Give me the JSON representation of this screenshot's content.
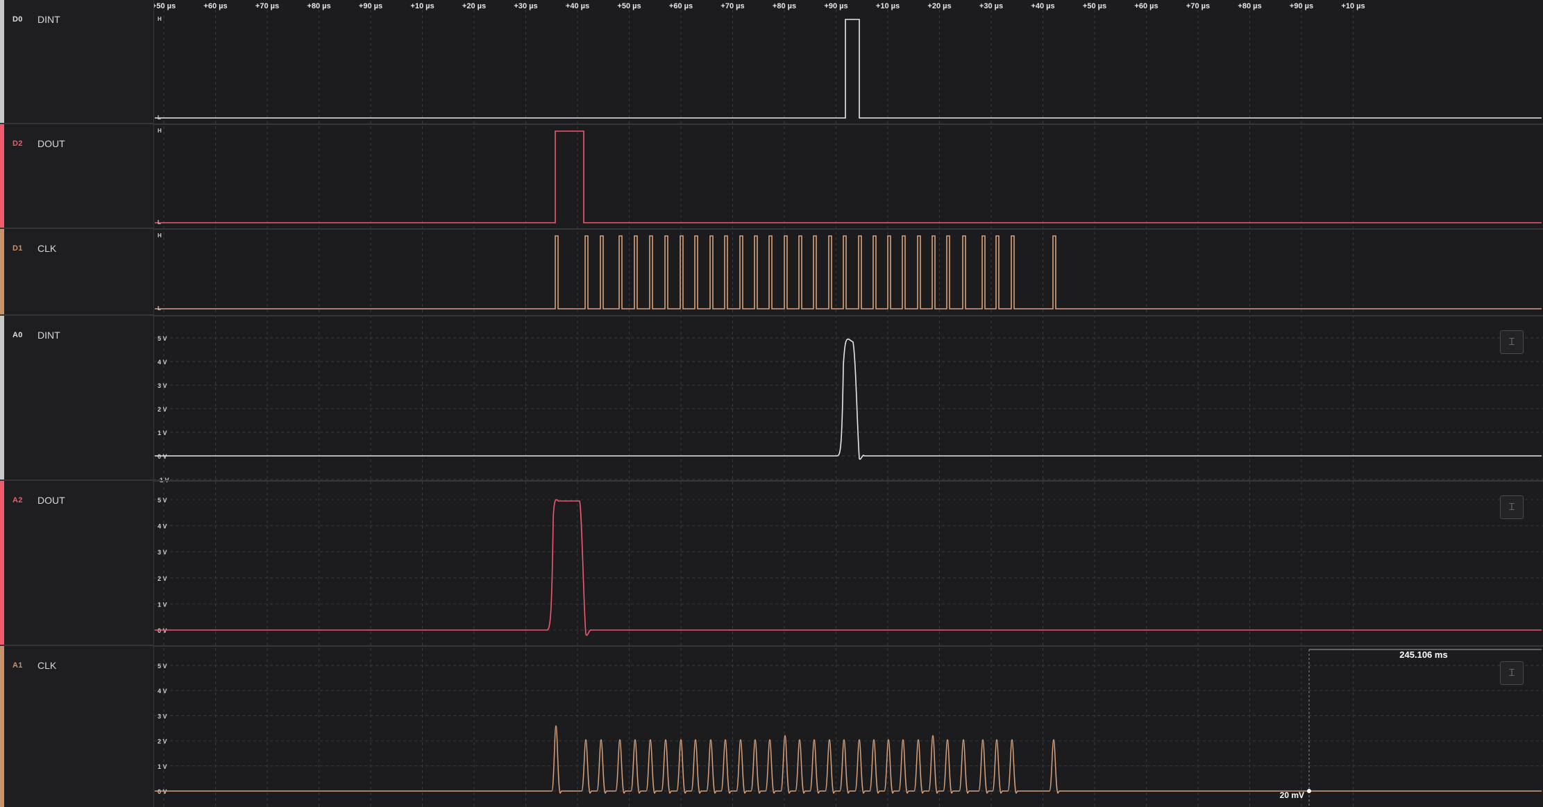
{
  "timeline": {
    "tick_labels": [
      "+50 µs",
      "+60 µs",
      "+70 µs",
      "+80 µs",
      "+90 µs",
      "+10 µs",
      "+20 µs",
      "+30 µs",
      "+40 µs",
      "+50 µs",
      "+60 µs",
      "+70 µs",
      "+80 µs",
      "+90 µs",
      "+10 µs",
      "+20 µs",
      "+30 µs",
      "+40 µs",
      "+50 µs",
      "+60 µs",
      "+70 µs",
      "+80 µs",
      "+90 µs",
      "+10 µs"
    ]
  },
  "channels": [
    {
      "id": "D0",
      "name": "DINT",
      "kind": "digital",
      "color": "#e8e8e8",
      "id_color": "#e0e0e0",
      "level_high": "H",
      "level_low": "L"
    },
    {
      "id": "D2",
      "name": "DOUT",
      "kind": "digital",
      "color": "#ef5a6f",
      "id_color": "#ef5a6f",
      "level_high": "H",
      "level_low": "L"
    },
    {
      "id": "D1",
      "name": "CLK",
      "kind": "digital",
      "color": "#d8a27d",
      "id_color": "#c8926b",
      "level_high": "H",
      "level_low": "L"
    },
    {
      "id": "A0",
      "name": "DINT",
      "kind": "analog",
      "color": "#e8e8e8",
      "id_color": "#e0e0e0",
      "volt_labels": [
        "5 V",
        "4 V",
        "3 V",
        "2 V",
        "1 V",
        "0 V",
        "-1 V"
      ]
    },
    {
      "id": "A2",
      "name": "DOUT",
      "kind": "analog",
      "color": "#ef5a6f",
      "id_color": "#ef5a6f",
      "volt_labels": [
        "5 V",
        "4 V",
        "3 V",
        "2 V",
        "1 V",
        "0 V"
      ]
    },
    {
      "id": "A1",
      "name": "CLK",
      "kind": "analog",
      "color": "#d8a27d",
      "id_color": "#c8926b",
      "volt_labels": [
        "5 V",
        "4 V",
        "3 V",
        "2 V",
        "1 V",
        "0 V"
      ]
    }
  ],
  "measurement": {
    "width_label": "245.106 ms",
    "offset_label": "20 mV"
  },
  "colors": {
    "background": "#1c1c1e",
    "grid": "#3a3a3e",
    "separator": "#36363a",
    "text": "#d8d8d8"
  },
  "icons": {
    "autoscale": "vertical-fit-icon"
  }
}
